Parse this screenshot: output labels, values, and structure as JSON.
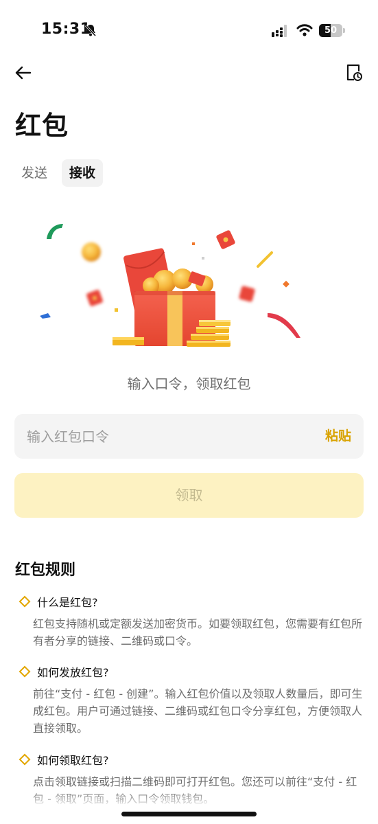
{
  "status": {
    "time": "15:31",
    "battery_level": "50",
    "icons": [
      "bell-slash-icon",
      "signal-icon",
      "wifi-icon",
      "battery-icon"
    ]
  },
  "nav": {
    "back_icon": "arrow-left-icon",
    "history_icon": "document-clock-icon"
  },
  "page": {
    "title": "红包"
  },
  "tabs": [
    {
      "label": "发送",
      "active": false
    },
    {
      "label": "接收",
      "active": true
    }
  ],
  "receive": {
    "hint": "输入口令，领取红包",
    "input_placeholder": "输入红包口令",
    "input_value": "",
    "paste_label": "粘贴",
    "claim_label": "领取"
  },
  "rules": {
    "title": "红包规则",
    "items": [
      {
        "question": "什么是红包?",
        "answer": "红包支持随机或定额发送加密货币。如要领取红包，您需要有红包所有者分享的链接、二维码或口令。"
      },
      {
        "question": "如何发放红包?",
        "answer": "前往“支付 - 红包 - 创建”。输入红包价值以及领取人数量后，即可生成红包。用户可通过链接、二维码或红包口令分享红包，方便领取人直接领取。"
      },
      {
        "question": "如何领取红包?",
        "answer": "点击领取链接或扫描二维码即可打开红包。您还可以前往“支付 - 红包 - 领取”页面，输入口令领取钱包。"
      }
    ]
  },
  "colors": {
    "accent": "#E3A600",
    "claim_button_bg": "#FDF2C2",
    "input_bg": "#F4F4F4",
    "red_packet": "#E9473A"
  }
}
